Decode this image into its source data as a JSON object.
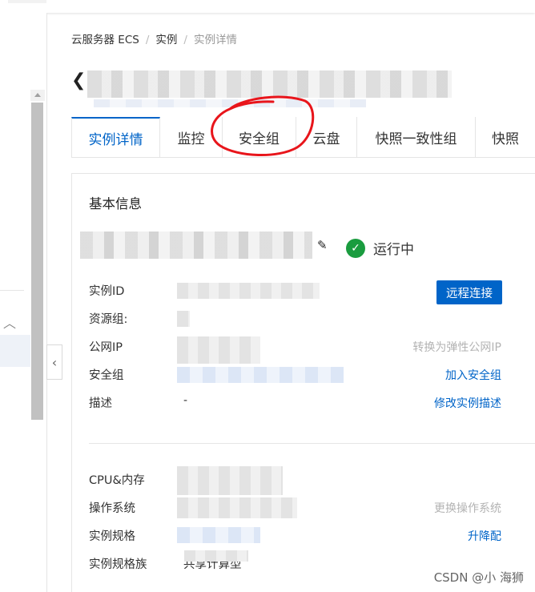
{
  "breadcrumb": {
    "items": [
      "云服务器 ECS",
      "实例",
      "实例详情"
    ],
    "separator": "/"
  },
  "tabs": [
    "实例详情",
    "监控",
    "安全组",
    "云盘",
    "快照一致性组",
    "快照"
  ],
  "card": {
    "title": "基本信息",
    "status": "运行中",
    "rows": [
      {
        "label": "实例ID",
        "value": "",
        "action": ""
      },
      {
        "label": "资源组:",
        "value": "",
        "action": ""
      },
      {
        "label": "公网IP",
        "value": "",
        "action": "转换为弹性公网IP"
      },
      {
        "label": "安全组",
        "value": "",
        "action": "加入安全组"
      },
      {
        "label": "描述",
        "value": "-",
        "action": "修改实例描述"
      },
      {
        "label": "CPU&内存",
        "value": "",
        "action": ""
      },
      {
        "label": "操作系统",
        "value": "",
        "action": "更换操作系统"
      },
      {
        "label": "实例规格",
        "value": "",
        "action": "升降配"
      },
      {
        "label": "实例规格族",
        "value": "共享计算型",
        "action": ""
      }
    ],
    "remote_button": "远程连接"
  },
  "watermark": "CSDN @小 海狮",
  "colors": {
    "accent": "#0064c8",
    "success": "#1a9c3f",
    "annotation": "#e8151b",
    "muted_action": "#b3b3b3"
  }
}
